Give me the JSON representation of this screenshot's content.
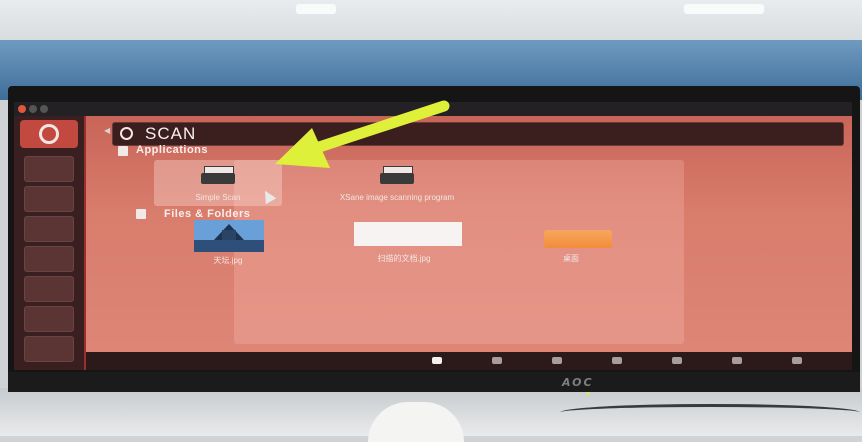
{
  "search": {
    "query": "SCAN"
  },
  "sections": {
    "applications": "Applications",
    "files_folders": "Files & Folders"
  },
  "applications": [
    {
      "label": "Simple Scan",
      "icon": "scanner-icon"
    },
    {
      "label": "XSane image scanning program",
      "icon": "scanner-icon"
    }
  ],
  "files": [
    {
      "label": "天坛.jpg",
      "icon": "image-thumbnail-icon"
    },
    {
      "label": "扫描的文档.jpg",
      "icon": "document-thumbnail-icon"
    },
    {
      "label": "桌面",
      "icon": "folder-icon"
    }
  ],
  "monitor": {
    "brand": "AOC"
  },
  "colors": {
    "dash_bg": "#d97d6d",
    "launcher_bg": "#3a1f20",
    "accent": "#c2493f",
    "annotation_arrow": "#dff03a"
  }
}
